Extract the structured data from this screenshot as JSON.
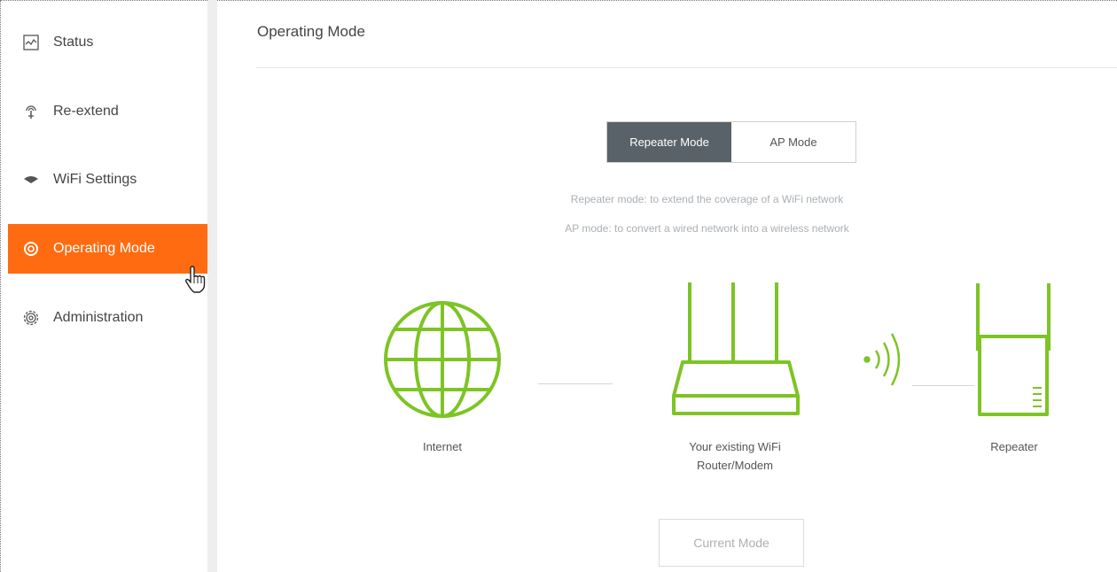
{
  "sidebar": {
    "items": [
      {
        "label": "Status",
        "icon": "status-chart-icon"
      },
      {
        "label": "Re-extend",
        "icon": "antenna-icon"
      },
      {
        "label": "WiFi Settings",
        "icon": "wifi-icon"
      },
      {
        "label": "Operating Mode",
        "icon": "operating-mode-icon",
        "active": true
      },
      {
        "label": "Administration",
        "icon": "gear-icon"
      }
    ]
  },
  "main": {
    "title": "Operating Mode",
    "mode_switch": {
      "repeater_label": "Repeater Mode",
      "ap_label": "AP Mode",
      "selected": "Repeater Mode"
    },
    "descriptions": {
      "repeater": "Repeater mode: to extend the coverage of a WiFi network",
      "ap": "AP mode: to convert a wired network into a wireless network"
    },
    "diagram": {
      "internet_label": "Internet",
      "router_label_line1": "Your existing WiFi",
      "router_label_line2": "Router/Modem",
      "repeater_label": "Repeater"
    },
    "current_mode_button": "Current Mode"
  },
  "colors": {
    "accent": "#ff6b11",
    "illustration_green": "#7dc425",
    "active_tab": "#596269"
  }
}
